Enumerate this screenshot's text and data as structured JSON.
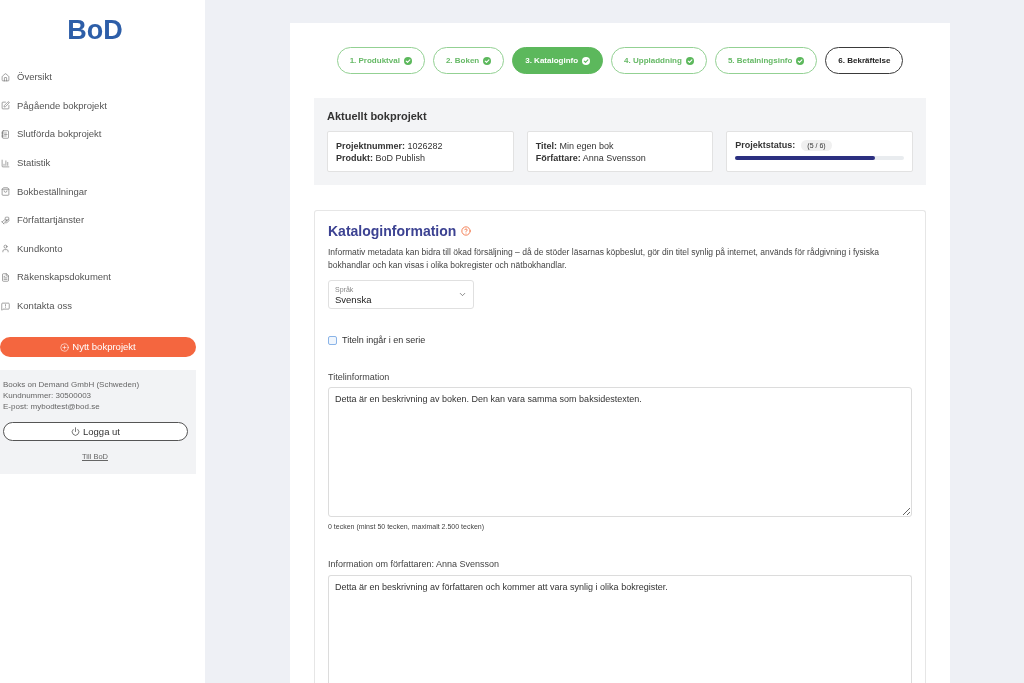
{
  "sidebar": {
    "logo": "BoD",
    "nav": [
      "Översikt",
      "Pågående bokprojekt",
      "Slutförda bokprojekt",
      "Statistik",
      "Bokbeställningar",
      "Författartjänster",
      "Kundkonto",
      "Räkenskapsdokument",
      "Kontakta oss"
    ],
    "new_project_button": "Nytt bokprojekt",
    "account": {
      "lines": [
        "Books on Demand GmbH (Schweden)",
        "Kundnummer: 30500003",
        "E-post: mybodtest@bod.se"
      ],
      "logout_button": "Logga ut",
      "link": "Till BoD"
    }
  },
  "steps": [
    {
      "label": "1. Produktval",
      "done": true,
      "selected": false
    },
    {
      "label": "2. Boken",
      "done": true,
      "selected": false
    },
    {
      "label": "3. Kataloginfo",
      "done": true,
      "selected": true
    },
    {
      "label": "4. Uppladdning",
      "done": true,
      "selected": false
    },
    {
      "label": "5. Betalningsinfo",
      "done": true,
      "selected": false
    },
    {
      "label": "6. Bekräftelse",
      "done": false,
      "selected": false
    }
  ],
  "project": {
    "title": "Aktuellt bokprojekt",
    "cards": [
      [
        "**Projektnummer:** 1026282",
        "**Produkt:** BoD Publish"
      ],
      [
        "**Titel:** Min egen bok",
        "**Författare:** Anna Svensson"
      ]
    ],
    "status": {
      "label": "Projektstatus:",
      "count": "(5 / 6)",
      "level": 0.83
    }
  },
  "catalog": {
    "title": "Kataloginformation",
    "description": "Informativ metadata kan bidra till ökad försäljning – då de stöder läsarnas köpbeslut, gör din titel synlig på internet, används för rådgivning i fysiska bokhandlar och kan visas i olika bokregister och nätbokhandlar.",
    "language_select": {
      "label": "Språk",
      "value": "Svenska"
    },
    "series_checkbox": {
      "label": "Titeln ingår i en serie",
      "checked": false
    },
    "title_info": {
      "label": "Titelinformation",
      "placeholder": "Detta är en beskrivning av boken. Den kan vara samma som baksidestexten.",
      "counter": "0 tecken (minst 50 tecken, maximalt 2.500 tecken)"
    },
    "author_info": {
      "label": "Information om författaren: Anna Svensson",
      "placeholder": "Detta är en beskrivning av författaren och kommer att vara synlig i olika bokregister."
    }
  }
}
